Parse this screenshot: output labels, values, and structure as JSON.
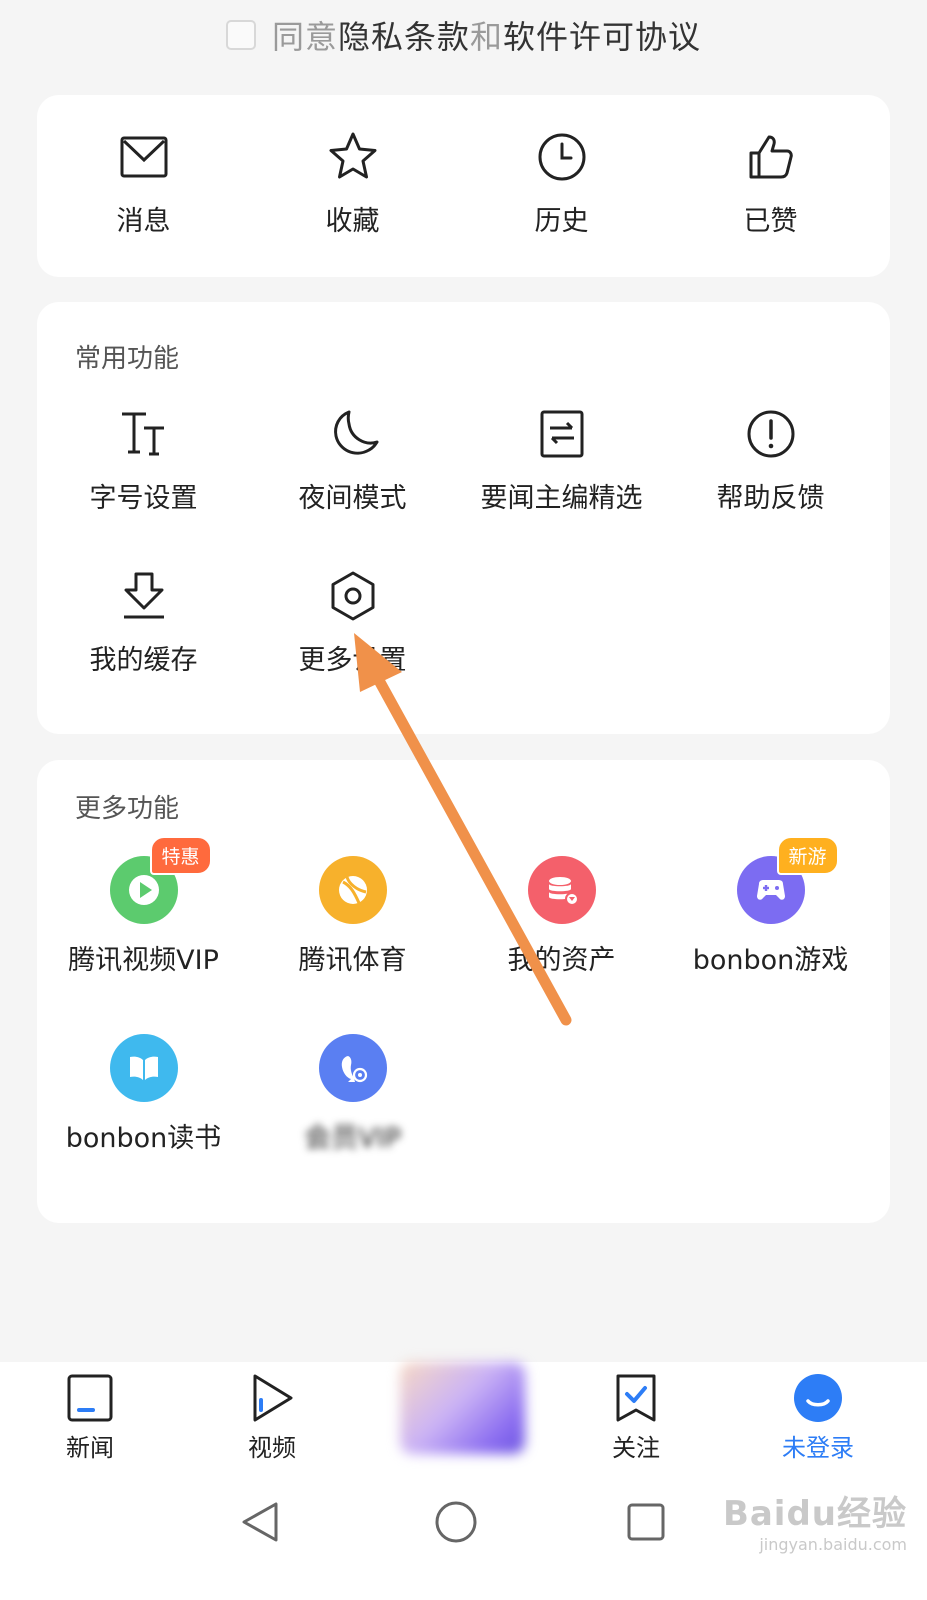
{
  "agreement": {
    "prefix": "同意",
    "privacy": "隐私条款",
    "and": "和",
    "license": "软件许可协议"
  },
  "quick_actions": [
    {
      "label": "消息",
      "icon": "mail-icon"
    },
    {
      "label": "收藏",
      "icon": "star-icon"
    },
    {
      "label": "历史",
      "icon": "clock-icon"
    },
    {
      "label": "已赞",
      "icon": "thumbs-up-icon"
    }
  ],
  "common_functions": {
    "title": "常用功能",
    "items": [
      {
        "label": "字号设置",
        "icon": "font-size-icon"
      },
      {
        "label": "夜间模式",
        "icon": "moon-icon"
      },
      {
        "label": "要闻主编精选",
        "icon": "editor-picks-icon"
      },
      {
        "label": "帮助反馈",
        "icon": "help-icon"
      },
      {
        "label": "我的缓存",
        "icon": "download-icon"
      },
      {
        "label": "更多设置",
        "icon": "settings-hex-icon"
      }
    ]
  },
  "more_functions": {
    "title": "更多功能",
    "items": [
      {
        "label": "腾讯视频VIP",
        "icon": "play-icon",
        "color": "#5ccb6e",
        "badge": "特惠",
        "badge_color": "#ff6a3d"
      },
      {
        "label": "腾讯体育",
        "icon": "ball-icon",
        "color": "#f7b12c"
      },
      {
        "label": "我的资产",
        "icon": "database-icon",
        "color": "#f4606b"
      },
      {
        "label": "bonbon游戏",
        "icon": "gamepad-icon",
        "color": "#7c6cf2",
        "badge": "新游",
        "badge_color": "#ffb01f"
      },
      {
        "label": "bonbon读书",
        "icon": "book-icon",
        "color": "#3fb9ee"
      },
      {
        "label": "会员VIP",
        "icon": "penguin-icon",
        "color": "#5a7ff2",
        "blurred": true
      }
    ]
  },
  "bottom_nav": [
    {
      "label": "新闻",
      "icon": "news-icon"
    },
    {
      "label": "视频",
      "icon": "video-icon"
    },
    {
      "label": "关注",
      "icon": "bookmark-icon"
    },
    {
      "label": "未登录",
      "icon": "avatar-icon",
      "active": true
    }
  ],
  "colors": {
    "accent": "#2d7df6",
    "arrow": "#f0914a"
  },
  "watermark": {
    "main": "Baidu经验",
    "sub": "jingyan.baidu.com"
  }
}
